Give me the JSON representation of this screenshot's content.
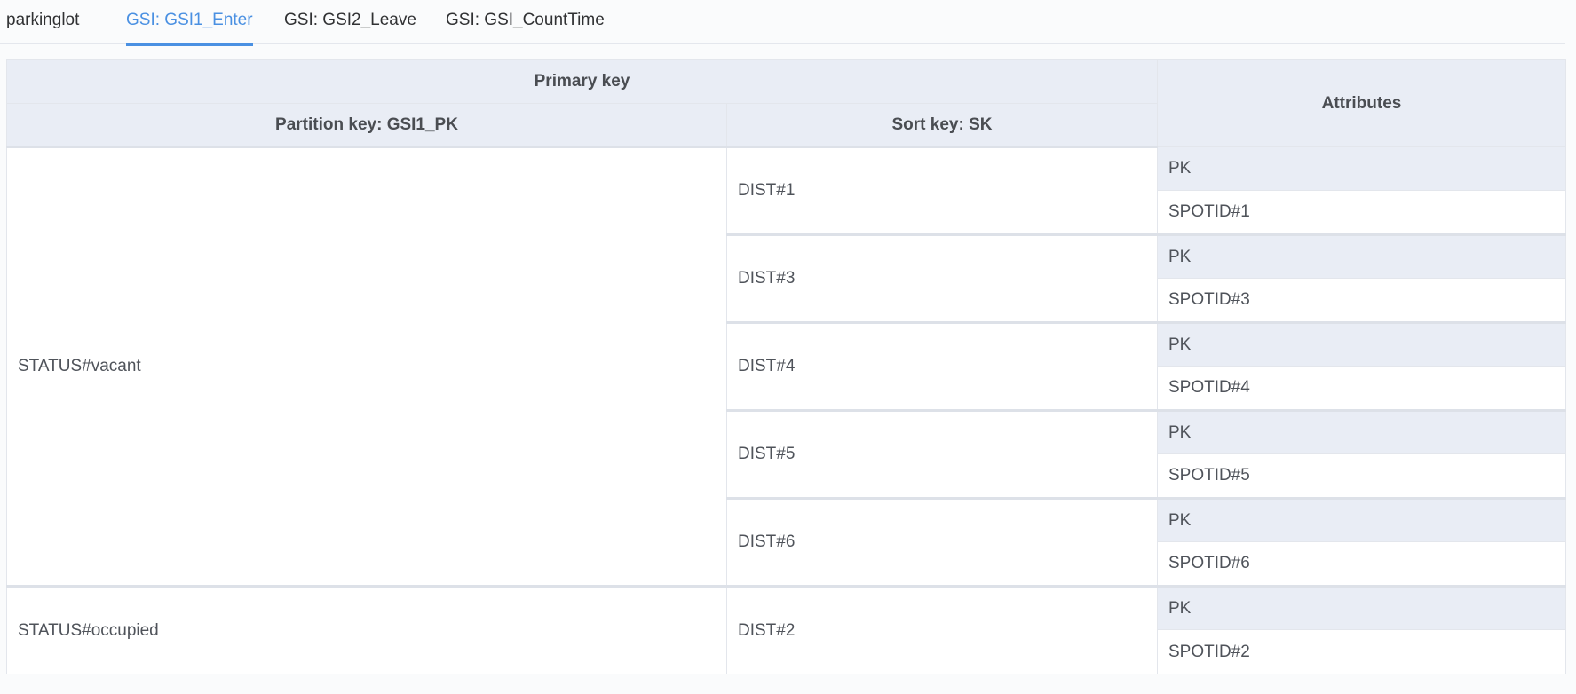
{
  "tabs": [
    {
      "label": "parkinglot",
      "active": false
    },
    {
      "label": "GSI: GSI1_Enter",
      "active": true
    },
    {
      "label": "GSI: GSI2_Leave",
      "active": false
    },
    {
      "label": "GSI: GSI_CountTime",
      "active": false
    }
  ],
  "table": {
    "primary_key_header": "Primary key",
    "partition_key_header": "Partition key: GSI1_PK",
    "sort_key_header": "Sort key: SK",
    "attributes_header": "Attributes",
    "groups": [
      {
        "partition": "STATUS#vacant",
        "items": [
          {
            "sort": "DIST#1",
            "attr_name": "PK",
            "attr_value": "SPOTID#1"
          },
          {
            "sort": "DIST#3",
            "attr_name": "PK",
            "attr_value": "SPOTID#3"
          },
          {
            "sort": "DIST#4",
            "attr_name": "PK",
            "attr_value": "SPOTID#4"
          },
          {
            "sort": "DIST#5",
            "attr_name": "PK",
            "attr_value": "SPOTID#5"
          },
          {
            "sort": "DIST#6",
            "attr_name": "PK",
            "attr_value": "SPOTID#6"
          }
        ]
      },
      {
        "partition": "STATUS#occupied",
        "items": [
          {
            "sort": "DIST#2",
            "attr_name": "PK",
            "attr_value": "SPOTID#2"
          }
        ]
      }
    ]
  },
  "colors": {
    "accent": "#4a90e2",
    "header_bg": "#e9edf5",
    "border": "#e3e6ec"
  }
}
